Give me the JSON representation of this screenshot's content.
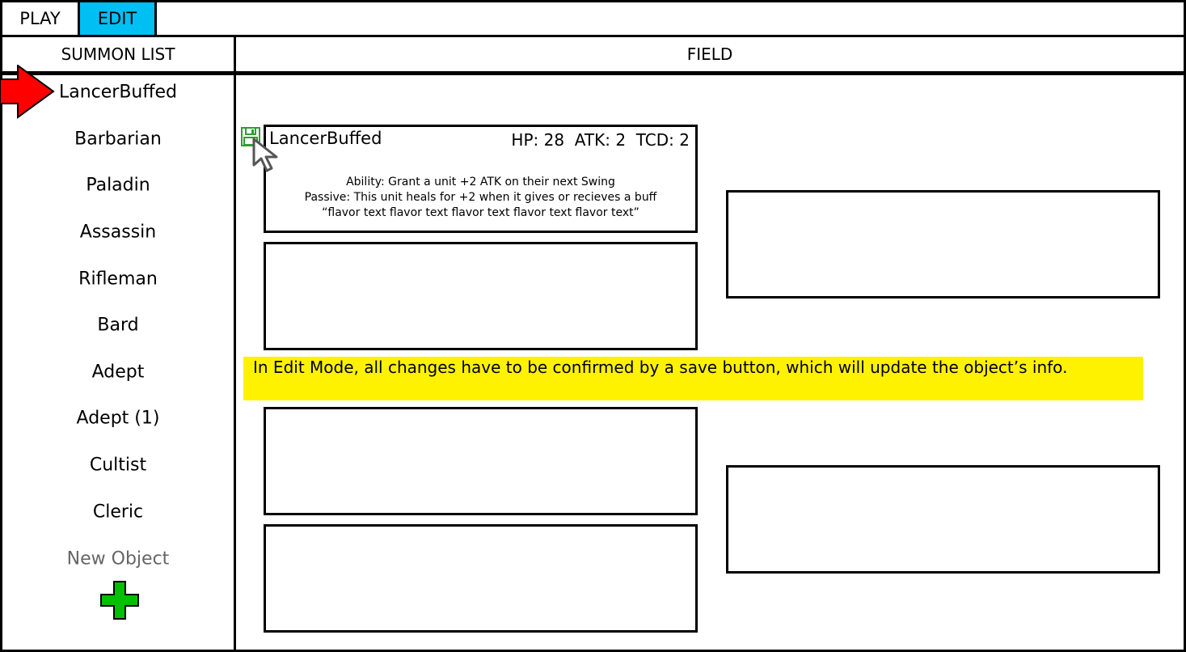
{
  "tabs": {
    "play": "PLAY",
    "edit": "EDIT"
  },
  "colors": {
    "active_tab": "#00BFF3",
    "note_bg": "#FFF200",
    "arrow": "#FF0000",
    "plus": "#00C000",
    "save": "#2E9E2E"
  },
  "summon_list": {
    "title": "SUMMON LIST",
    "items": [
      "LancerBuffed",
      "Barbarian",
      "Paladin",
      "Assassin",
      "Rifleman",
      "Bard",
      "Adept",
      "Adept (1)",
      "Cultist",
      "Cleric"
    ],
    "selected": "LancerBuffed",
    "new_object_label": "New Object",
    "icons": {
      "selected_marker": "red-arrow-icon",
      "add": "plus-icon"
    }
  },
  "field": {
    "title": "FIELD",
    "unit_card": {
      "name": "LancerBuffed",
      "stats": "HP: 28  ATK: 2  TCD: 2",
      "ability": "Ability: Grant a unit +2 ATK on their next Swing",
      "passive": "Passive: This unit heals for +2 when it gives or recieves a buff",
      "flavor": "“flavor text flavor text flavor text flavor text flavor text”",
      "icons": {
        "save": "save-icon",
        "cursor": "cursor-icon"
      }
    },
    "note": "In Edit Mode, all changes have to be confirmed by a save button, which will update the object’s info."
  }
}
